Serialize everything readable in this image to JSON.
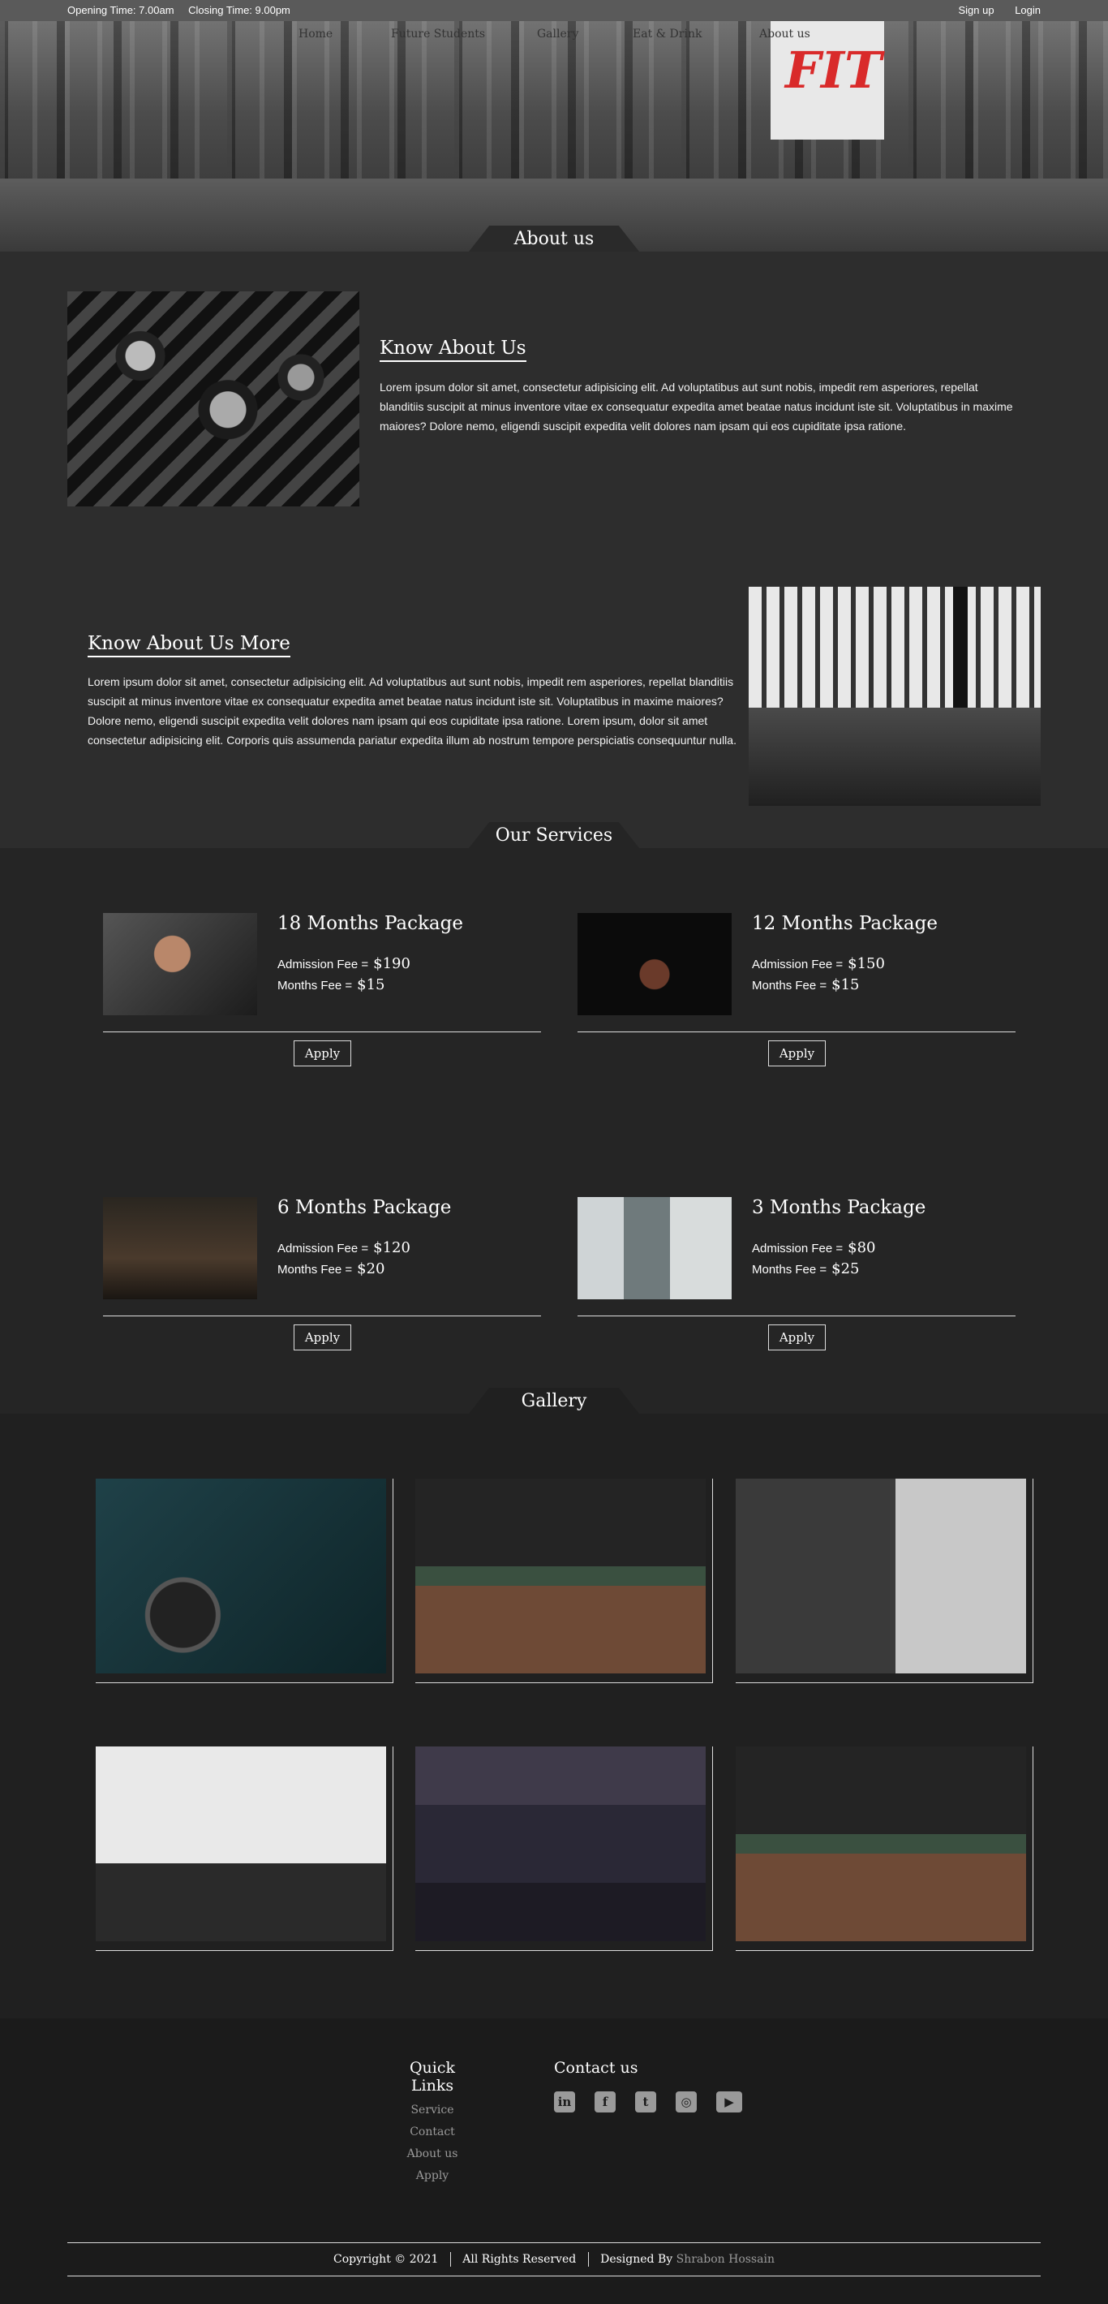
{
  "topbar": {
    "opening": "Opening Time: 7.00am",
    "closing": "Closing Time: 9.00pm",
    "signup": "Sign up",
    "login": "Login"
  },
  "nav": {
    "items": [
      "Home",
      "Future Students",
      "Gallery",
      "Eat & Drink",
      "About us"
    ]
  },
  "hero": {
    "sign_text": "FIT"
  },
  "about": {
    "tab": "About us",
    "block1_title": "Know About Us",
    "block1_text": "Lorem ipsum dolor sit amet, consectetur adipisicing elit. Ad voluptatibus aut sunt nobis, impedit rem asperiores, repellat blanditiis suscipit at minus inventore vitae ex consequatur expedita amet beatae natus incidunt iste sit. Voluptatibus in maxime maiores? Dolore nemo, eligendi suscipit expedita velit dolores nam ipsam qui eos cupiditate ipsa ratione.",
    "block2_title": "Know About Us More",
    "block2_text": "Lorem ipsum dolor sit amet, consectetur adipisicing elit. Ad voluptatibus aut sunt nobis, impedit rem asperiores, repellat blanditiis suscipit at minus inventore vitae ex consequatur expedita amet beatae natus incidunt iste sit. Voluptatibus in maxime maiores? Dolore nemo, eligendi suscipit expedita velit dolores nam ipsam qui eos cupiditate ipsa ratione. Lorem ipsum, dolor sit amet consectetur adipisicing elit. Corporis quis assumenda pariatur expedita illum ab nostrum tempore perspiciatis consequuntur nulla."
  },
  "services": {
    "tab": "Our Services",
    "admission_label": "Admission Fee =",
    "months_label": "Months Fee =",
    "apply_label": "Apply",
    "packages": [
      {
        "name": "18 Months Package",
        "admission": "$190",
        "monthly": "$15"
      },
      {
        "name": "12 Months Package",
        "admission": "$150",
        "monthly": "$15"
      },
      {
        "name": "6 Months Package",
        "admission": "$120",
        "monthly": "$20"
      },
      {
        "name": "3 Months Package",
        "admission": "$80",
        "monthly": "$25"
      }
    ]
  },
  "gallery": {
    "tab": "Gallery"
  },
  "footer": {
    "quick_links_title": "Quick Links",
    "links": [
      "Service",
      "Contact",
      "About us",
      "Apply"
    ],
    "contact_title": "Contact us",
    "socials": [
      "linkedin-icon",
      "facebook-icon",
      "twitter-icon",
      "instagram-icon",
      "youtube-icon"
    ],
    "copyright": "Copyright",
    "year": "2021",
    "rights": "All Rights Reserved",
    "designed_by": "Designed By",
    "designer": "Shrabon Hossain"
  }
}
